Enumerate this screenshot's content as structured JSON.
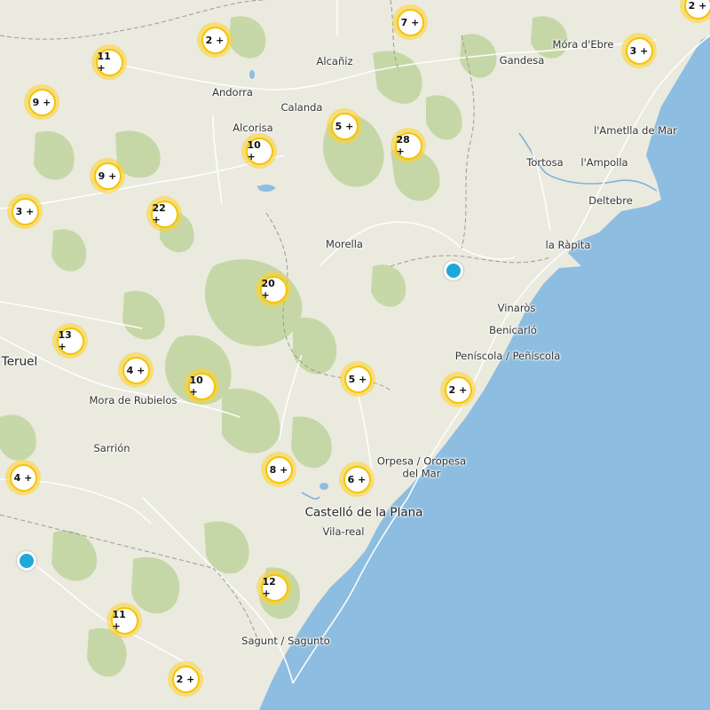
{
  "colors": {
    "land": "#ebeadf",
    "sea": "#8dbde0",
    "forest": "#c3d6a2",
    "road": "#ffffff",
    "border": "#9a9a9a",
    "cluster_ring": "#f5c400",
    "pin": "#1ea9d9"
  },
  "places": [
    {
      "name": "Alcañiz"
    },
    {
      "name": "Gandesa"
    },
    {
      "name": "Móra d'Ebre"
    },
    {
      "name": "Andorra"
    },
    {
      "name": "Calanda"
    },
    {
      "name": "Alcorisa"
    },
    {
      "name": "l'Ametlla de Mar"
    },
    {
      "name": "Tortosa"
    },
    {
      "name": "l'Ampolla"
    },
    {
      "name": "Deltebre"
    },
    {
      "name": "Morella"
    },
    {
      "name": "la Ràpita"
    },
    {
      "name": "Vinaròs"
    },
    {
      "name": "Benicarló"
    },
    {
      "name": "Peníscola / Peñíscola"
    },
    {
      "name": "Teruel"
    },
    {
      "name": "Mora de Rubielos"
    },
    {
      "name": "Sarrión"
    },
    {
      "name": "Orpesa / Oropesa\ndel Mar"
    },
    {
      "name": "Castelló de la Plana"
    },
    {
      "name": "Vila-real"
    },
    {
      "name": "Sagunt / Sagunto"
    }
  ],
  "clusters": [
    {
      "label": "2 +"
    },
    {
      "label": "7 +"
    },
    {
      "label": "3 +"
    },
    {
      "label": "2 +"
    },
    {
      "label": "11 +"
    },
    {
      "label": "9 +"
    },
    {
      "label": "5 +"
    },
    {
      "label": "10 +"
    },
    {
      "label": "28 +"
    },
    {
      "label": "9 +"
    },
    {
      "label": "3 +"
    },
    {
      "label": "22 +"
    },
    {
      "label": "20 +"
    },
    {
      "label": "13 +"
    },
    {
      "label": "4 +"
    },
    {
      "label": "10 +"
    },
    {
      "label": "5 +"
    },
    {
      "label": "2 +"
    },
    {
      "label": "4 +"
    },
    {
      "label": "8 +"
    },
    {
      "label": "6 +"
    },
    {
      "label": "12 +"
    },
    {
      "label": "11 +"
    },
    {
      "label": "2 +"
    }
  ],
  "pins": [
    {
      "name": "location-pin-1"
    },
    {
      "name": "location-pin-2"
    }
  ]
}
